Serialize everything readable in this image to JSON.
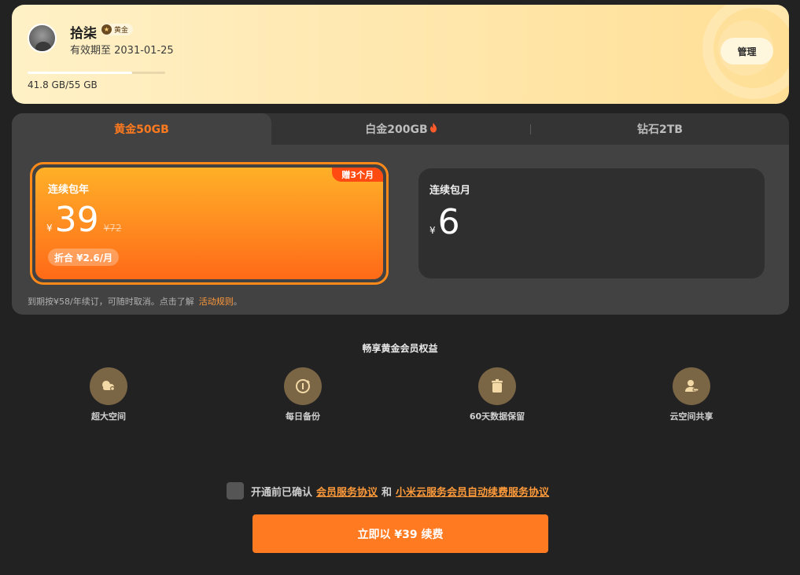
{
  "header": {
    "username": "拾柒",
    "member_badge": "黄金",
    "validity": "有效期至 2031-01-25",
    "manage_label": "管理",
    "storage_text": "41.8 GB/55 GB",
    "storage_used_fraction": 0.76
  },
  "tabs": [
    {
      "label": "黄金50GB",
      "active": true
    },
    {
      "label": "白金200GB",
      "active": false
    },
    {
      "label": "钻石2TB",
      "active": false
    }
  ],
  "plans": {
    "yearly": {
      "title": "连续包年",
      "currency": "¥",
      "price": "39",
      "original_price": "¥72",
      "gift_tag": "赠3个月",
      "unit_price": "折合 ¥2.6/月"
    },
    "monthly": {
      "title": "连续包月",
      "currency": "¥",
      "price": "6"
    }
  },
  "renew_note": {
    "text": "到期按¥58/年续订，可随时取消。点击了解",
    "link": "活动规则",
    "suffix": "。"
  },
  "benefits": {
    "title": "畅享黄金会员权益",
    "items": [
      {
        "label": "超大空间",
        "icon": "cloud-icon"
      },
      {
        "label": "每日备份",
        "icon": "backup-icon"
      },
      {
        "label": "60天数据保留",
        "icon": "trash-icon"
      },
      {
        "label": "云空间共享",
        "icon": "share-user-icon"
      }
    ]
  },
  "agreement": {
    "prefix": "开通前已确认",
    "link1": "会员服务协议",
    "and": "和",
    "link2": "小米云服务会员自动续费服务协议"
  },
  "cta": {
    "label": "立即以 ¥39 续费"
  },
  "colors": {
    "accent": "#ff7a21",
    "header_bg": "#ffe9b3",
    "page_bg": "#222222",
    "panel_bg": "#424242"
  }
}
